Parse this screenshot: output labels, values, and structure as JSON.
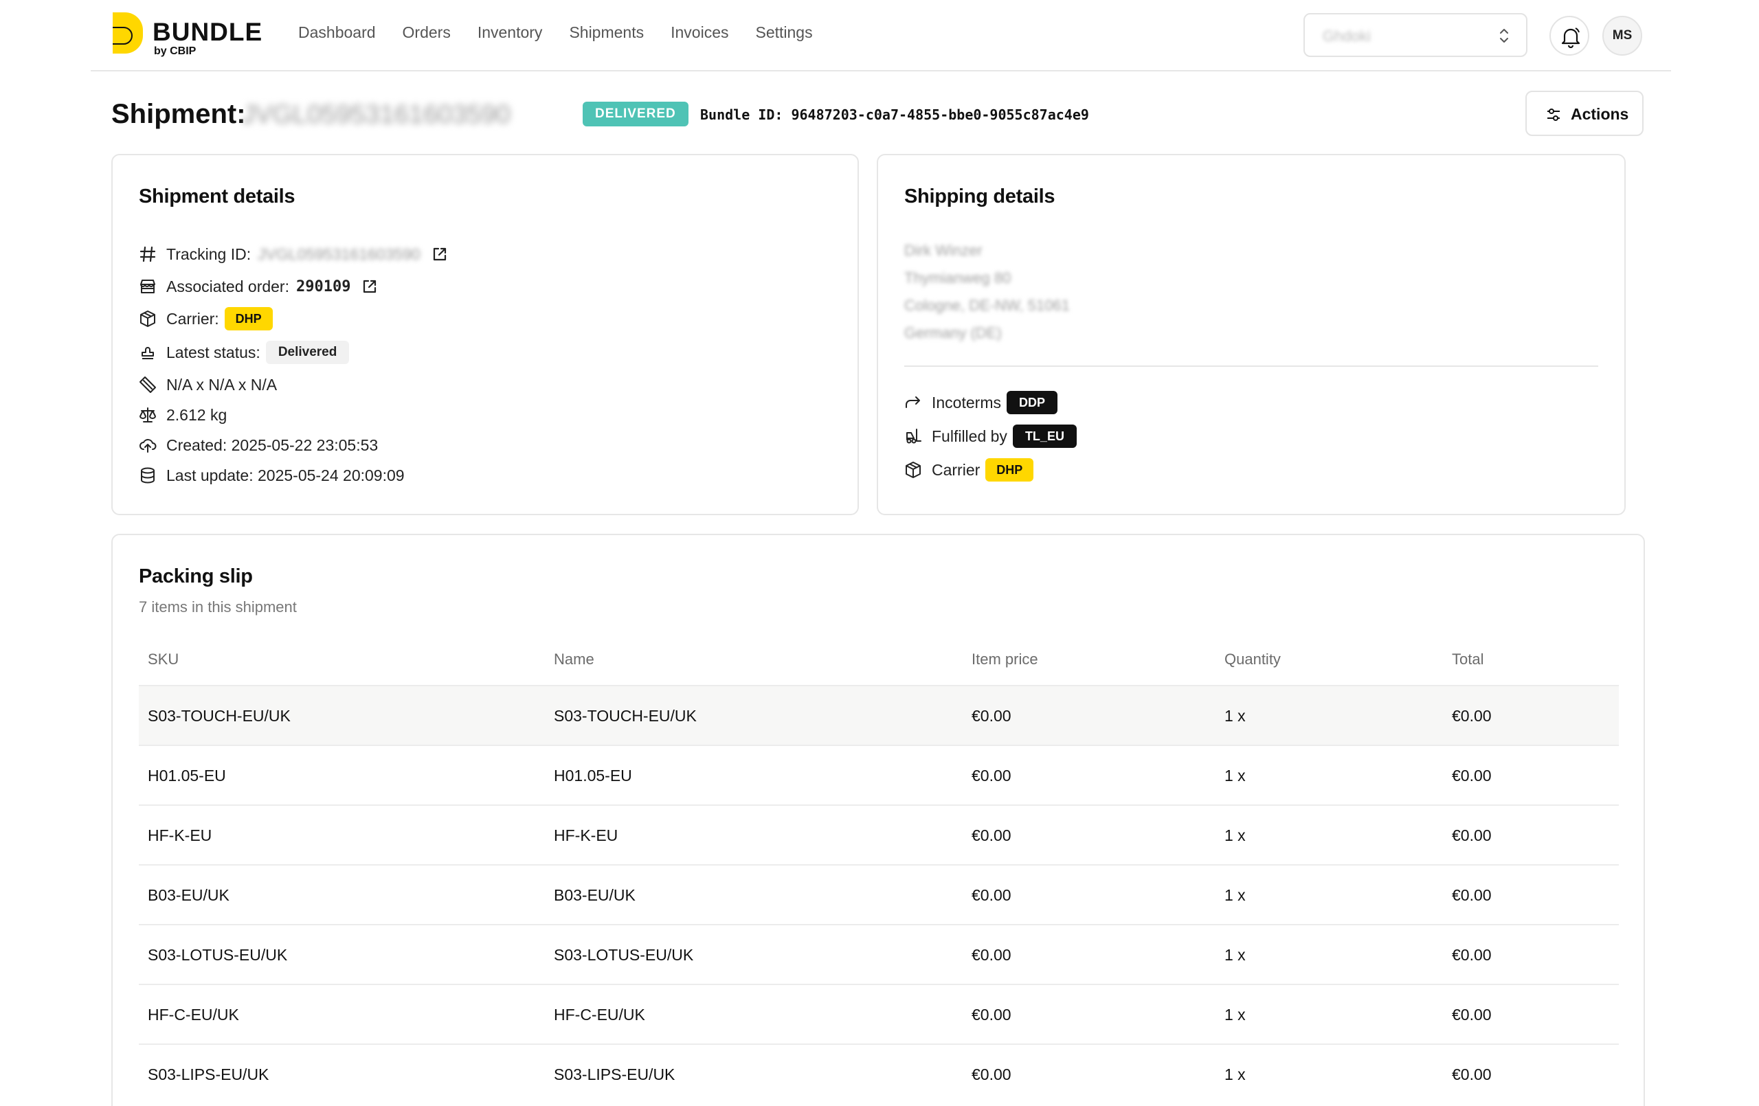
{
  "header": {
    "brand": "BUNDLE",
    "brand_sub": "by CBIP",
    "nav": [
      "Dashboard",
      "Orders",
      "Inventory",
      "Shipments",
      "Invoices",
      "Settings"
    ],
    "org_selector_value": "Ghdoki",
    "avatar_initials": "MS"
  },
  "title": {
    "label": "Shipment:",
    "shipment_id": "JVGL05953161603590",
    "status_badge": "DELIVERED",
    "bundle_id": "Bundle ID: 96487203-c0a7-4855-bbe0-9055c87ac4e9",
    "actions_label": "Actions"
  },
  "shipment_details": {
    "title": "Shipment details",
    "tracking_label": "Tracking ID:",
    "tracking_value": "JVGL05953161603590",
    "order_label": "Associated order:",
    "order_value": "290109",
    "carrier_label": "Carrier:",
    "carrier_value": "DHP",
    "status_label": "Latest status:",
    "status_value": "Delivered",
    "dimensions": "N/A x N/A x N/A",
    "weight": "2.612 kg",
    "created": "Created: 2025-05-22 23:05:53",
    "last_update": "Last update: 2025-05-24 20:09:09"
  },
  "shipping_details": {
    "title": "Shipping details",
    "address": [
      "Dirk Winzer",
      "Thymianweg 80",
      "Cologne, DE-NW, 51061",
      "Germany (DE)"
    ],
    "incoterms_label": "Incoterms",
    "incoterms_value": "DDP",
    "fulfilled_label": "Fulfilled by",
    "fulfilled_value": "TL_EU",
    "carrier_label": "Carrier",
    "carrier_value": "DHP"
  },
  "packing_slip": {
    "title": "Packing slip",
    "subtitle": "7 items in this shipment",
    "columns": [
      "SKU",
      "Name",
      "Item price",
      "Quantity",
      "Total"
    ],
    "rows": [
      {
        "sku": "S03-TOUCH-EU/UK",
        "name": "S03-TOUCH-EU/UK",
        "price": "€0.00",
        "qty": "1 x",
        "total": "€0.00"
      },
      {
        "sku": "H01.05-EU",
        "name": "H01.05-EU",
        "price": "€0.00",
        "qty": "1 x",
        "total": "€0.00"
      },
      {
        "sku": "HF-K-EU",
        "name": "HF-K-EU",
        "price": "€0.00",
        "qty": "1 x",
        "total": "€0.00"
      },
      {
        "sku": "B03-EU/UK",
        "name": "B03-EU/UK",
        "price": "€0.00",
        "qty": "1 x",
        "total": "€0.00"
      },
      {
        "sku": "S03-LOTUS-EU/UK",
        "name": "S03-LOTUS-EU/UK",
        "price": "€0.00",
        "qty": "1 x",
        "total": "€0.00"
      },
      {
        "sku": "HF-C-EU/UK",
        "name": "HF-C-EU/UK",
        "price": "€0.00",
        "qty": "1 x",
        "total": "€0.00"
      },
      {
        "sku": "S03-LIPS-EU/UK",
        "name": "S03-LIPS-EU/UK",
        "price": "€0.00",
        "qty": "1 x",
        "total": "€0.00"
      }
    ]
  },
  "colors": {
    "brand_yellow": "#ffd700",
    "delivered_badge": "#4fc3b5",
    "dark_tag": "#111111"
  },
  "icons": {
    "tracking": "hash-icon",
    "order": "store-icon",
    "carrier": "package-icon",
    "status": "stamp-icon",
    "dimensions": "ruler-icon",
    "weight": "scale-icon",
    "created": "cloud-upload-icon",
    "last_update": "database-icon",
    "incoterms": "arrow-forward-icon",
    "fulfilled": "forklift-icon"
  }
}
